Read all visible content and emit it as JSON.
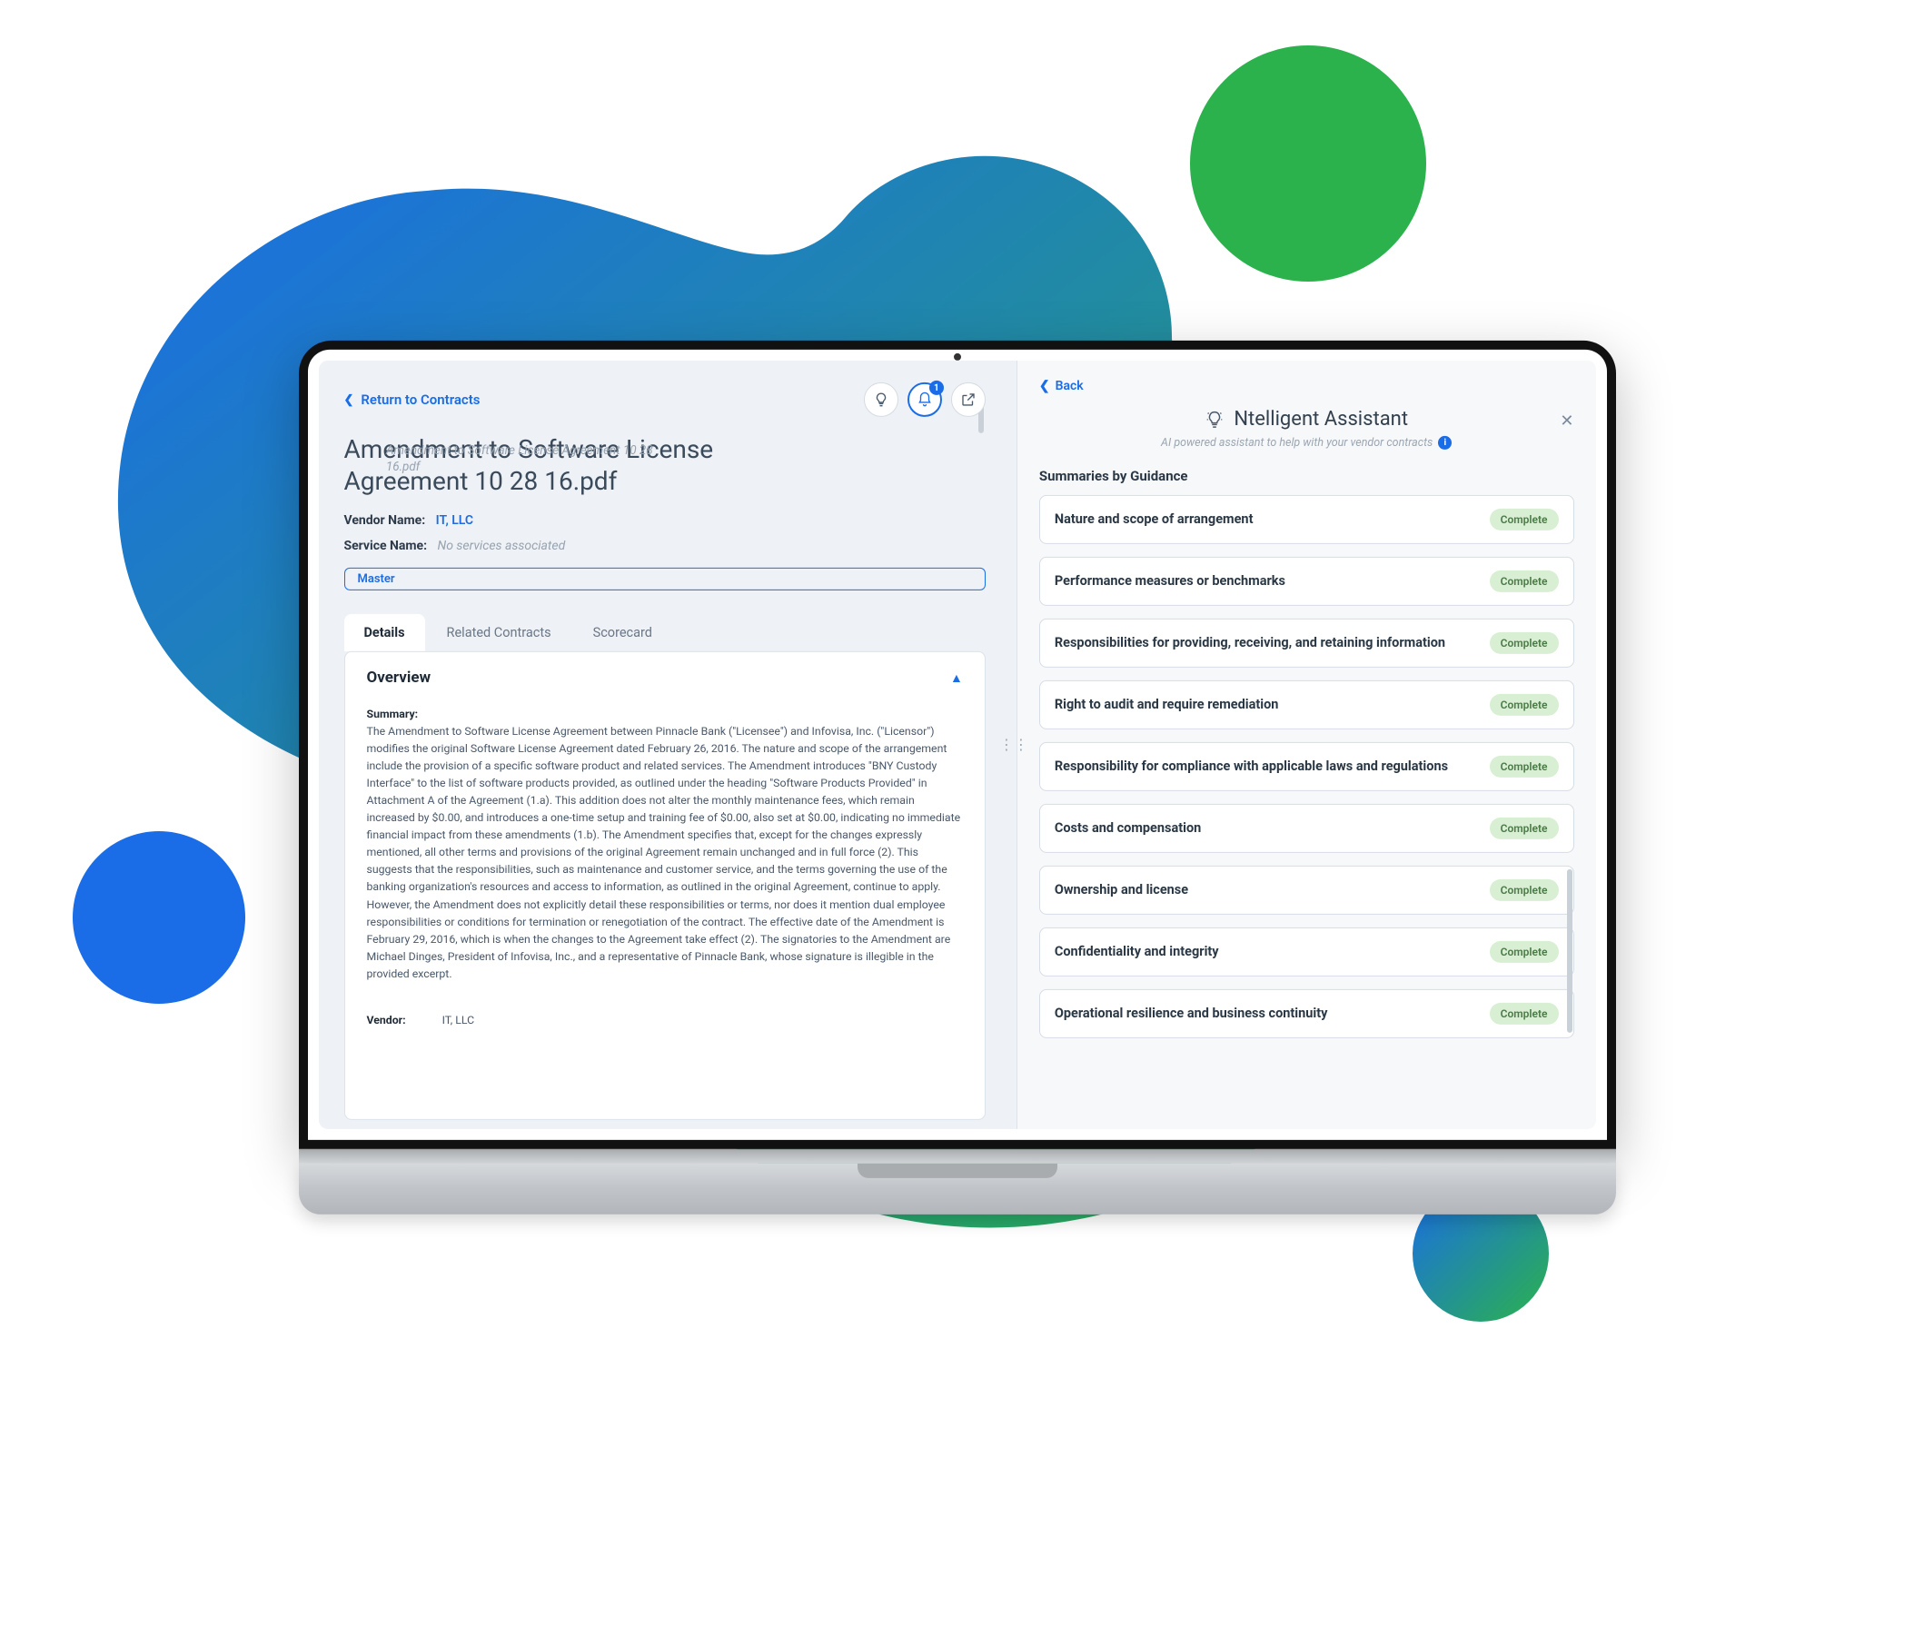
{
  "colors": {
    "blue": "#1a6de6",
    "green": "#2bb24c"
  },
  "left": {
    "return_label": "Return to Contracts",
    "notification_count": "1",
    "title": "Amendment to Software License Agreement 10 28 16.pdf",
    "file_subtitle": "Amendment to Software License Agreement 10 28 16.pdf",
    "vendor_name_label": "Vendor Name:",
    "vendor_name_value": "IT, LLC",
    "service_name_label": "Service Name:",
    "service_name_value": "No services associated",
    "chip": "Master",
    "tabs": [
      "Details",
      "Related Contracts",
      "Scorecard"
    ],
    "overview": {
      "heading": "Overview",
      "summary_label": "Summary:",
      "summary_text": "The Amendment to Software License Agreement between Pinnacle Bank (\"Licensee\") and Infovisa, Inc. (\"Licensor\") modifies the original Software License Agreement dated February 26, 2016. The nature and scope of the arrangement include the provision of a specific software product and related services. The Amendment introduces \"BNY Custody Interface\" to the list of software products provided, as outlined under the heading \"Software Products Provided\" in Attachment A of the Agreement (1.a). This addition does not alter the monthly maintenance fees, which remain increased by $0.00, and introduces a one-time setup and training fee of $0.00, also set at $0.00, indicating no immediate financial impact from these amendments (1.b). The Amendment specifies that, except for the changes expressly mentioned, all other terms and provisions of the original Agreement remain unchanged and in full force (2). This suggests that the responsibilities, such as maintenance and customer service, and the terms governing the use of the banking organization's resources and access to information, as outlined in the original Agreement, continue to apply. However, the Amendment does not explicitly detail these responsibilities or terms, nor does it mention dual employee responsibilities or conditions for termination or renegotiation of the contract. The effective date of the Amendment is February 29, 2016, which is when the changes to the Agreement take effect (2). The signatories to the Amendment are Michael Dinges, President of Infovisa, Inc., and a representative of Pinnacle Bank, whose signature is illegible in the provided excerpt.",
      "vendor_label": "Vendor:",
      "vendor_value": "IT, LLC"
    }
  },
  "right": {
    "back_label": "Back",
    "title": "Ntelligent Assistant",
    "subtitle": "AI powered assistant to help with your vendor contracts",
    "section_label": "Summaries by Guidance",
    "status_label": "Complete",
    "summaries": [
      {
        "title": "Nature and scope of arrangement",
        "status": "Complete"
      },
      {
        "title": "Performance measures or benchmarks",
        "status": "Complete"
      },
      {
        "title": "Responsibilities for providing, receiving, and retaining information",
        "status": "Complete"
      },
      {
        "title": "Right to audit and require remediation",
        "status": "Complete"
      },
      {
        "title": "Responsibility for compliance with applicable laws and regulations",
        "status": "Complete"
      },
      {
        "title": "Costs and compensation",
        "status": "Complete"
      },
      {
        "title": "Ownership and license",
        "status": "Complete"
      },
      {
        "title": "Confidentiality and integrity",
        "status": "Complete"
      },
      {
        "title": "Operational resilience and business continuity",
        "status": "Complete"
      }
    ]
  }
}
